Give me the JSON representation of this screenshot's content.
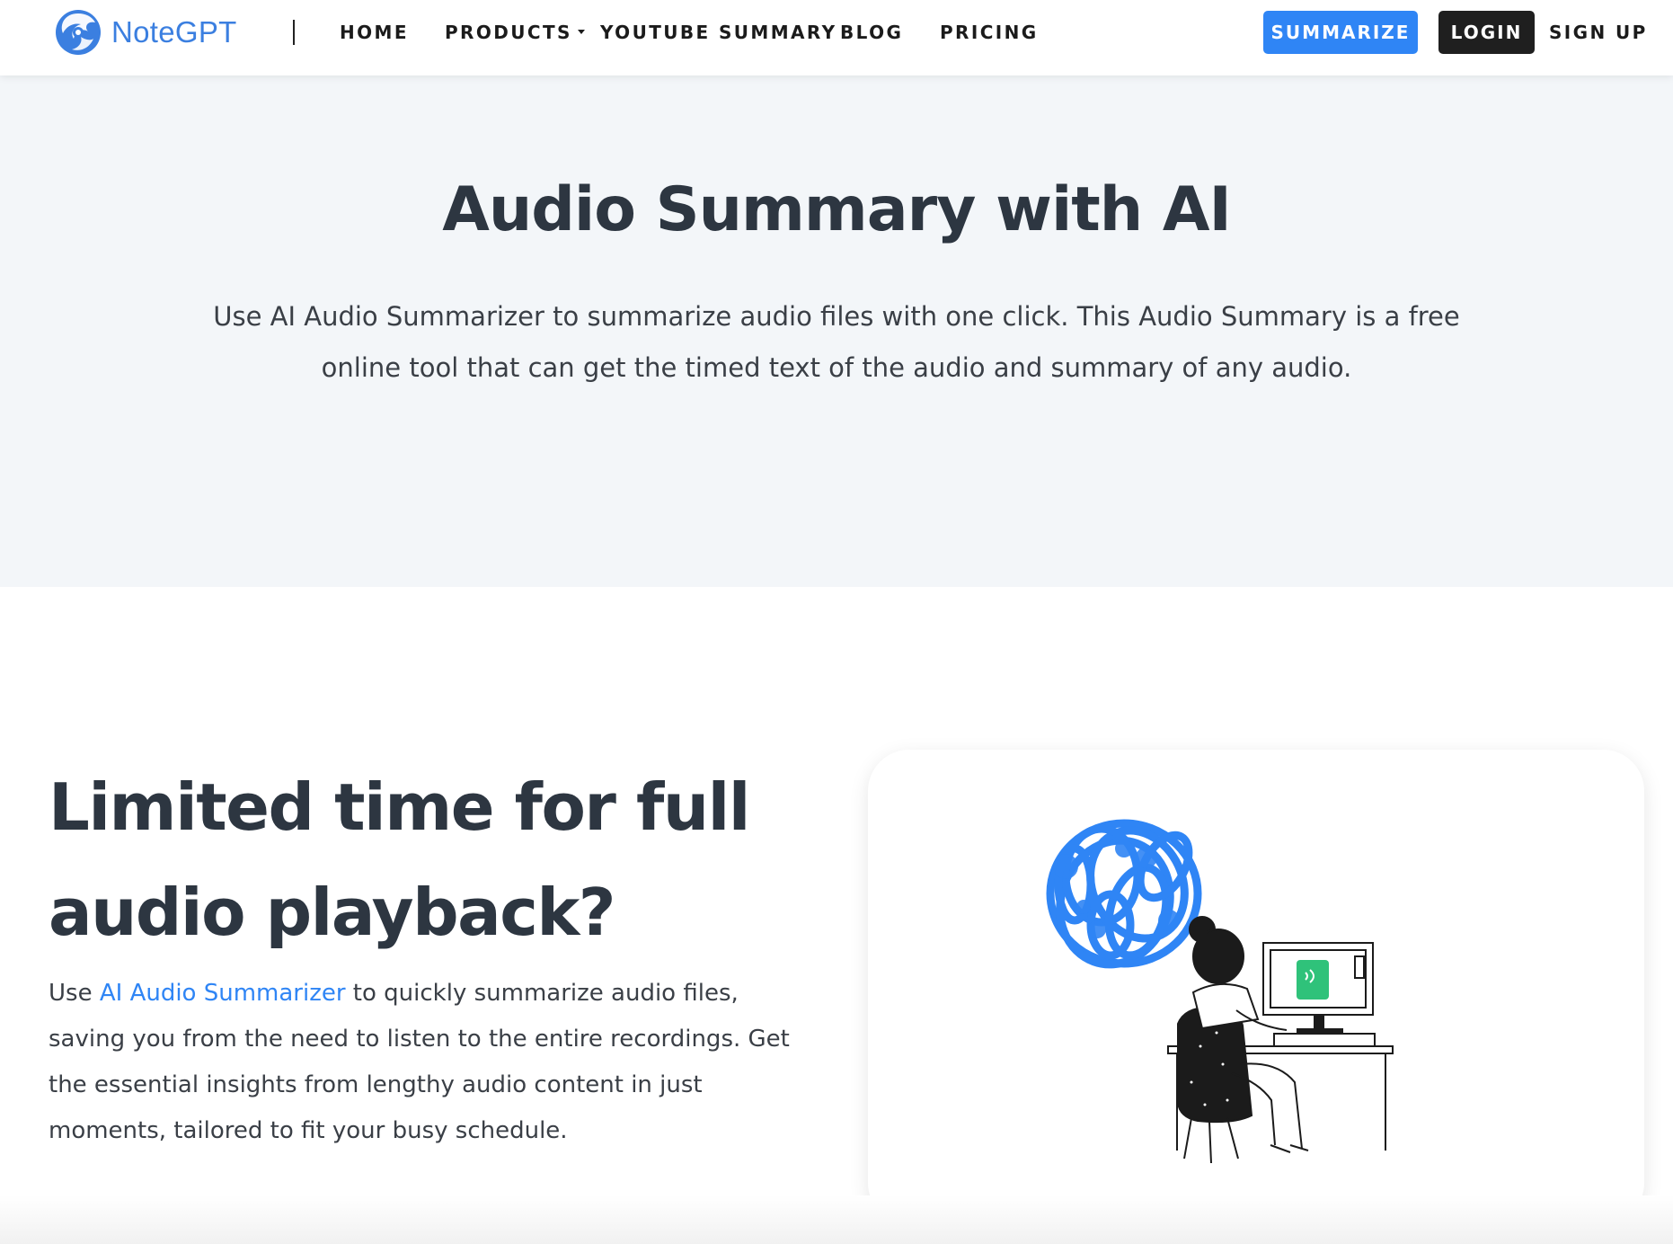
{
  "brand": {
    "name": "NoteGPT",
    "logo_icon": "swirl-logo-icon",
    "accent": "#2f85f5"
  },
  "nav": {
    "home": "HOME",
    "products": "PRODUCTS",
    "youtube_summary": "YOUTUBE SUMMARY",
    "blog": "BLOG",
    "pricing": "PRICING",
    "summarize": "SUMMARIZE",
    "login": "LOGIN",
    "signup": "SIGN UP"
  },
  "hero": {
    "title": "Audio Summary with AI",
    "description": "Use AI Audio Summarizer to summarize audio files with one click. This Audio Summary is a free online tool that can get the timed text of the audio and summary of any audio."
  },
  "feature": {
    "title": "Limited time for full audio playback?",
    "desc_before": "Use ",
    "desc_link": "AI Audio Summarizer",
    "desc_after": " to quickly summarize audio files, saving you from the need to listen to the entire recordings. Get the essential insights from lengthy audio content in just moments, tailored to fit your busy schedule.",
    "illustration": "woman-at-computer-illustration"
  }
}
